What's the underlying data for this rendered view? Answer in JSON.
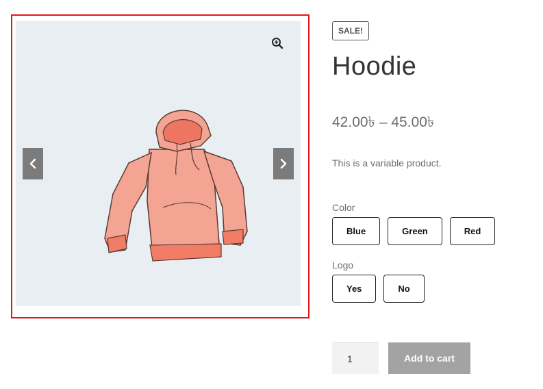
{
  "gallery": {
    "zoom_icon": "zoom-in-icon",
    "prev_icon": "chevron-left-icon",
    "next_icon": "chevron-right-icon",
    "highlight_color": "#e8141c"
  },
  "product": {
    "badge": "SALE!",
    "title": "Hoodie",
    "price": "42.00৳ – 45.00৳",
    "description": "This is a variable product."
  },
  "attributes": {
    "color": {
      "label": "Color",
      "options": [
        "Blue",
        "Green",
        "Red"
      ]
    },
    "logo": {
      "label": "Logo",
      "options": [
        "Yes",
        "No"
      ]
    }
  },
  "cart": {
    "quantity": "1",
    "add_label": "Add to cart",
    "button_color": "#a3a3a3"
  }
}
